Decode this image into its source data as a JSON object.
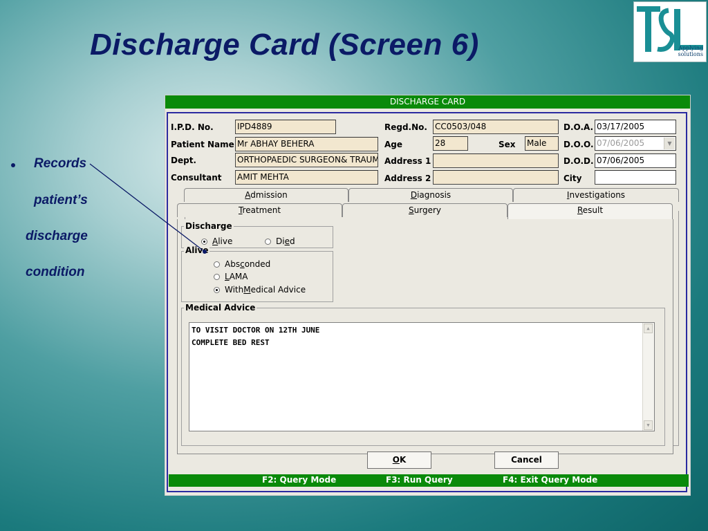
{
  "slide": {
    "title": "Discharge Card (Screen 6)",
    "logo_text": "TSL",
    "logo_tagline": "Applying solutions",
    "bullet_lines": [
      "Records",
      "patient’s",
      "discharge",
      "condition"
    ]
  },
  "window": {
    "title": "DISCHARGE CARD"
  },
  "form": {
    "ipd_no_label": "I.P.D. No.",
    "ipd_no_value": "IPD4889",
    "patient_name_label": "Patient Name",
    "patient_name_value": "Mr ABHAY BEHERA",
    "dept_label": "Dept.",
    "dept_value": "ORTHOPAEDIC SURGEON& TRAUMA",
    "consultant_label": "Consultant",
    "consultant_value": "AMIT MEHTA",
    "regd_no_label": "Regd.No.",
    "regd_no_value": "CC0503/048",
    "age_label": "Age",
    "age_value": "28",
    "sex_label": "Sex",
    "sex_value": "Male",
    "address1_label": "Address 1",
    "address1_value": "",
    "address2_label": "Address 2",
    "address2_value": "",
    "doa_label": "D.O.A.",
    "doa_value": "03/17/2005",
    "doo_label": "D.O.O.",
    "doo_value": "07/06/2005",
    "dod_label": "D.O.D.",
    "dod_value": "07/06/2005",
    "city_label": "City",
    "city_value": ""
  },
  "tabs": {
    "row1": [
      {
        "pre": "",
        "key": "A",
        "post": "dmission"
      },
      {
        "pre": "",
        "key": "D",
        "post": "iagnosis"
      },
      {
        "pre": "",
        "key": "I",
        "post": "nvestigations"
      }
    ],
    "row2": [
      {
        "pre": "",
        "key": "T",
        "post": "reatment"
      },
      {
        "pre": "",
        "key": "S",
        "post": "urgery"
      },
      {
        "pre": "",
        "key": "R",
        "post": "esult"
      }
    ],
    "active": "Result"
  },
  "result": {
    "discharge_group_label": "Discharge",
    "alive_option": {
      "pre": "",
      "key": "A",
      "post": "live"
    },
    "died_option": {
      "pre": "Di",
      "key": "e",
      "post": "d"
    },
    "discharge_selected": "Alive",
    "alive_group_label": "Alive",
    "absconded_option": {
      "pre": "Abs",
      "key": "c",
      "post": "onded"
    },
    "lama_option": {
      "pre": "",
      "key": "L",
      "post": "AMA"
    },
    "medical_advice_option": {
      "pre": "With ",
      "key": "M",
      "post": "edical Advice"
    },
    "alive_selected": "With Medical Advice",
    "medical_advice_group_label": "Medical Advice",
    "medical_advice_lines": [
      "TO VISIT DOCTOR ON 12TH JUNE",
      "COMPLETE BED REST"
    ]
  },
  "buttons": {
    "ok": {
      "pre": "",
      "key": "O",
      "post": "K"
    },
    "cancel": "Cancel"
  },
  "status": {
    "f2": "F2: Query Mode",
    "f3": "F3: Run Query",
    "f4": "F4: Exit Query Mode"
  },
  "colors": {
    "title_blue": "#0b1a66",
    "titlebar_green": "#0a8a0a",
    "field_beige": "#f2e7cf",
    "frame_blue": "#2a2aa0"
  }
}
